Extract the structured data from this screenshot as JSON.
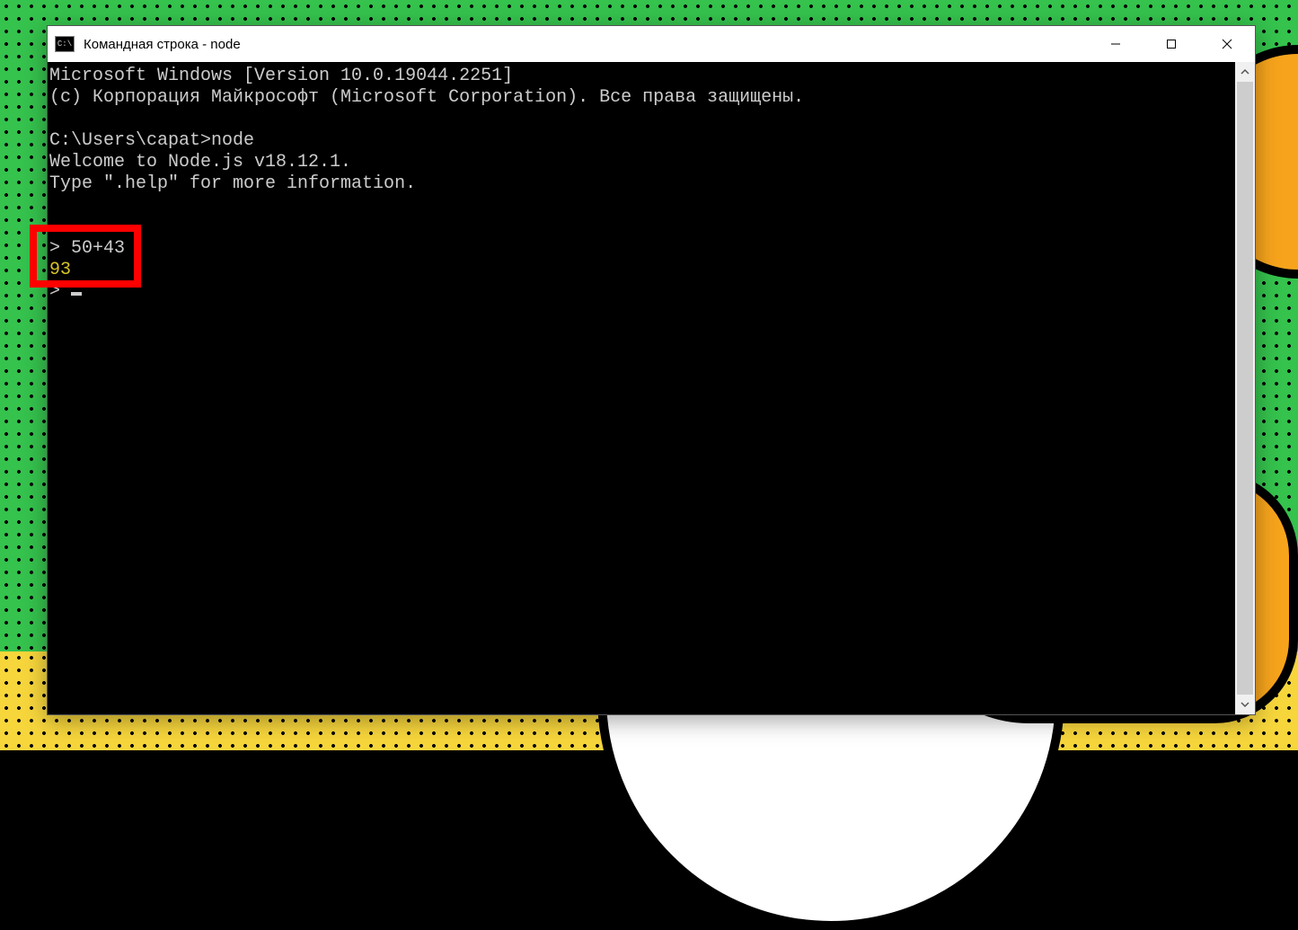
{
  "titlebar": {
    "icon_text": "C:\\",
    "title": "Командная строка - node"
  },
  "terminal": {
    "line_ms1": "Microsoft Windows [Version 10.0.19044.2251]",
    "line_ms2": "(c) Корпорация Майкрософт (Microsoft Corporation). Все права защищены.",
    "blank": "",
    "prompt_path": "C:\\Users\\capat>",
    "cmd_node": "node",
    "welcome": "Welcome to Node.js v18.12.1.",
    "help": "Type \".help\" for more information.",
    "repl_prompt": "> ",
    "input_expr": "50+43",
    "result": "93"
  }
}
